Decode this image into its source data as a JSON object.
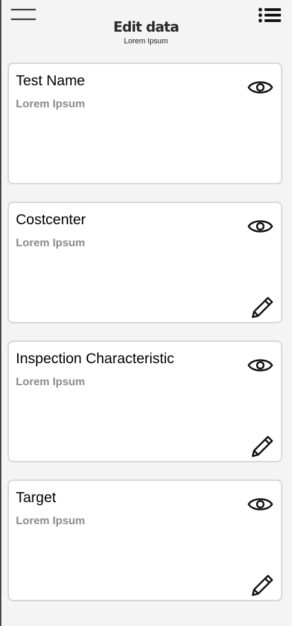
{
  "header": {
    "title": "Edit data",
    "subtitle": "Lorem Ipsum",
    "menu_icon": "hamburger-menu-icon",
    "list_icon": "bulleted-list-icon"
  },
  "cards": [
    {
      "title": "Test Name",
      "value": "Lorem Ipsum",
      "view_icon": "eye-icon",
      "editable": false
    },
    {
      "title": "Costcenter",
      "value": "Lorem Ipsum",
      "view_icon": "eye-icon",
      "edit_icon": "pencil-icon",
      "editable": true
    },
    {
      "title": "Inspection Characteristic",
      "value": "Lorem Ipsum",
      "view_icon": "eye-icon",
      "edit_icon": "pencil-icon",
      "editable": true
    },
    {
      "title": "Target",
      "value": "Lorem Ipsum",
      "view_icon": "eye-icon",
      "edit_icon": "pencil-icon",
      "editable": true
    }
  ]
}
